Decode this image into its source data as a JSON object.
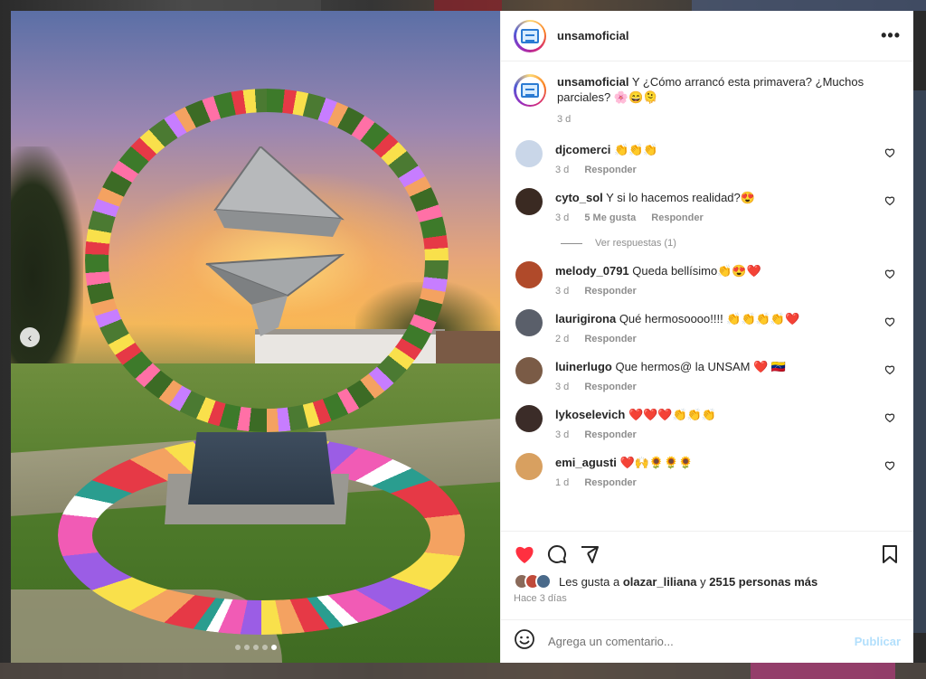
{
  "post": {
    "username": "unsamoficial",
    "caption_user": "unsamoficial",
    "caption_text": "Y ¿Cómo arrancó esta primavera? ¿Muchos parciales? 🌸😄🫠",
    "caption_time": "3 d"
  },
  "media": {
    "prev_icon": "‹",
    "dots": 5,
    "active_dot": 5
  },
  "comments": [
    {
      "user": "djcomerci",
      "text": "👏👏👏",
      "time": "3 d",
      "likes": "",
      "reply": "Responder",
      "color": "#c9d6e8"
    },
    {
      "user": "cyto_sol",
      "text": "Y si lo hacemos realidad?😍",
      "time": "3 d",
      "likes": "5 Me gusta",
      "reply": "Responder",
      "color": "#3a2a22"
    },
    {
      "user": "melody_0791",
      "text": "Queda bellísimo👏😍❤️",
      "time": "3 d",
      "likes": "",
      "reply": "Responder",
      "color": "#b04a2a"
    },
    {
      "user": "laurigirona",
      "text": "Qué hermosoooo!!!! 👏👏👏👏❤️",
      "time": "2 d",
      "likes": "",
      "reply": "Responder",
      "color": "#5a5f6a"
    },
    {
      "user": "luinerlugo",
      "text": "Que hermos@ la UNSAM ❤️ 🇻🇪",
      "time": "3 d",
      "likes": "",
      "reply": "Responder",
      "color": "#7a5b46"
    },
    {
      "user": "lykoselevich",
      "text": "❤️❤️❤️👏👏👏",
      "time": "3 d",
      "likes": "",
      "reply": "Responder",
      "color": "#3b2c28"
    },
    {
      "user": "emi_agusti",
      "text": "❤️🙌🌻🌻🌻",
      "time": "1 d",
      "likes": "",
      "reply": "Responder",
      "color": "#d8a060"
    }
  ],
  "view_replies": "Ver respuestas (1)",
  "likes": {
    "prefix": "Les gusta a",
    "user": "olazar_liliana",
    "middle": "y",
    "others": "2515 personas más"
  },
  "time_ago": "Hace 3 días",
  "comment_box": {
    "placeholder": "Agrega un comentario...",
    "publish": "Publicar"
  },
  "colors": {
    "like_red": "#ff3040",
    "publish_blue": "#b2dffc"
  }
}
